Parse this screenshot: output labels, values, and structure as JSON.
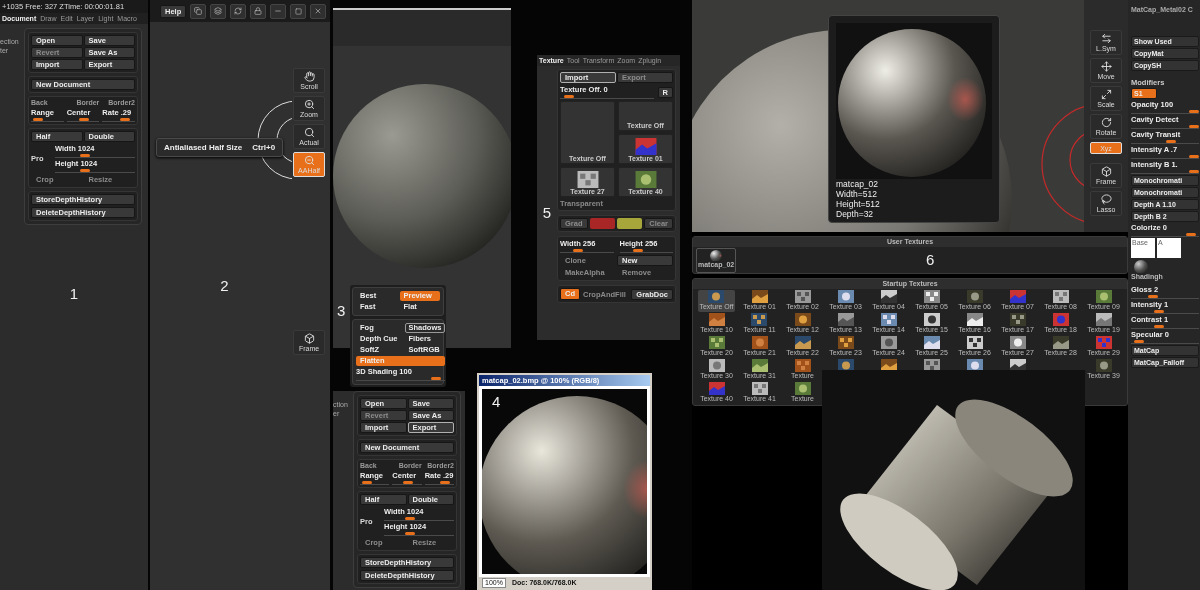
{
  "document_panel": {
    "number": "1",
    "status": "+1035 Free: 327 ZTime: 00:00:01.81",
    "tabs": [
      {
        "label": "Document",
        "selected": true
      },
      {
        "label": "Draw",
        "selected": false
      },
      {
        "label": "Edit",
        "selected": false
      },
      {
        "label": "Layer",
        "selected": false
      },
      {
        "label": "Light",
        "selected": false
      },
      {
        "label": "Macro",
        "selected": false
      }
    ],
    "side_labels": [
      "ection",
      "ter"
    ],
    "document": {
      "file_buttons": [
        {
          "label": "Open",
          "disabled": false,
          "selected": false
        },
        {
          "label": "Save",
          "disabled": false,
          "selected": false
        },
        {
          "label": "Revert",
          "disabled": true,
          "selected": false
        },
        {
          "label": "Save As",
          "disabled": false,
          "selected": false
        },
        {
          "label": "Import",
          "disabled": false,
          "selected": false
        },
        {
          "label": "Export",
          "disabled": false,
          "selected": false
        }
      ],
      "new_document": "New Document",
      "color_labels": [
        "Back",
        "Border",
        "Border2"
      ],
      "sliders": [
        {
          "label": "Range",
          "level": 0.08
        },
        {
          "label": "Center",
          "level": 0.55
        },
        {
          "label": "Rate .29",
          "level": 0.8
        }
      ],
      "size_buttons": [
        {
          "label": "Half",
          "disabled": false
        },
        {
          "label": "Double",
          "disabled": false
        }
      ],
      "pro_label": "Pro",
      "size_sliders": [
        {
          "label": "Width 1024",
          "level": 0.35
        },
        {
          "label": "Height 1024",
          "level": 0.35
        }
      ],
      "resize_buttons": [
        {
          "label": "Crop",
          "disabled": true
        },
        {
          "label": "Resize",
          "disabled": true
        }
      ],
      "history_buttons": [
        "StoreDepthHistory",
        "DeleteDepthHistory"
      ]
    }
  },
  "view_panel": {
    "number": "2",
    "help": "Help",
    "shelf": [
      {
        "label": "Scroll",
        "selected": false
      },
      {
        "label": "Zoom",
        "selected": false
      },
      {
        "label": "Actual",
        "selected": false
      },
      {
        "label": "AAHalf",
        "selected": true
      },
      {
        "label": "Frame",
        "selected": false
      }
    ],
    "tooltip": {
      "text": "Antialiased Half Size",
      "shortcut": "Ctrl+0"
    }
  },
  "render_panel": {
    "number": "3",
    "groups": [
      {
        "items": [
          {
            "kind": "option",
            "label": "Best",
            "selected": false,
            "outlined": false
          },
          {
            "kind": "option",
            "label": "Preview",
            "selected": true,
            "outlined": false
          },
          {
            "kind": "option",
            "label": "Fast",
            "selected": false,
            "outlined": false
          },
          {
            "kind": "option",
            "label": "Flat",
            "selected": false,
            "outlined": false
          }
        ]
      },
      {
        "items": [
          {
            "kind": "option",
            "label": "Fog",
            "selected": false,
            "outlined": false
          },
          {
            "kind": "option",
            "label": "Shadows",
            "selected": false,
            "outlined": true
          },
          {
            "kind": "option",
            "label": "Depth Cue",
            "selected": false,
            "outlined": false
          },
          {
            "kind": "option",
            "label": "Fibers",
            "selected": false,
            "outlined": false
          },
          {
            "kind": "option",
            "label": "SoftZ",
            "selected": false,
            "outlined": false
          },
          {
            "kind": "option",
            "label": "SoftRGB",
            "selected": false,
            "outlined": false
          },
          {
            "kind": "wide",
            "label": "Flatten",
            "selected": true,
            "outlined": false
          }
        ],
        "slider": {
          "label": "3D Shading 100",
          "level": 0.95
        }
      }
    ]
  },
  "document_panel_copy": {
    "side_labels": [
      "ction",
      "er"
    ],
    "document": {
      "file_buttons": [
        {
          "label": "Open",
          "disabled": false,
          "selected": false
        },
        {
          "label": "Save",
          "disabled": false,
          "selected": false
        },
        {
          "label": "Revert",
          "disabled": true,
          "selected": false
        },
        {
          "label": "Save As",
          "disabled": false,
          "selected": false
        },
        {
          "label": "Import",
          "disabled": false,
          "selected": false
        },
        {
          "label": "Export",
          "disabled": false,
          "selected": true
        }
      ],
      "new_document": "New Document",
      "color_labels": [
        "Back",
        "Border",
        "Border2"
      ],
      "sliders": [
        {
          "label": "Range",
          "level": 0.08
        },
        {
          "label": "Center",
          "level": 0.55
        },
        {
          "label": "Rate .29",
          "level": 0.8
        }
      ],
      "size_buttons": [
        {
          "label": "Half",
          "disabled": false
        },
        {
          "label": "Double",
          "disabled": false
        }
      ],
      "pro_label": "Pro",
      "size_sliders": [
        {
          "label": "Width 1024",
          "level": 0.35
        },
        {
          "label": "Height 1024",
          "level": 0.35
        }
      ],
      "resize_buttons": [
        {
          "label": "Crop",
          "disabled": true
        },
        {
          "label": "Resize",
          "disabled": true
        }
      ],
      "history_buttons": [
        "StoreDepthHistory",
        "DeleteDepthHistory"
      ]
    }
  },
  "image_window": {
    "number": "4",
    "title": "matcap_02.bmp @ 100% (RGB/8)",
    "zoom": "100%",
    "doc_size": "Doc: 768.0K/768.0K"
  },
  "texture_panel": {
    "number": "5",
    "tabs": [
      {
        "label": "Texture",
        "selected": true
      },
      {
        "label": "Tool",
        "selected": false
      },
      {
        "label": "Transform",
        "selected": false
      },
      {
        "label": "Zoom",
        "selected": false
      },
      {
        "label": "Zplugin",
        "selected": false
      }
    ],
    "import_buttons": [
      {
        "label": "Import",
        "disabled": false
      },
      {
        "label": "Export",
        "disabled": true
      }
    ],
    "slider": {
      "label": "Texture Off. 0",
      "level": 0.05
    },
    "reset_label": "R",
    "thumbs": [
      {
        "kind": "empty",
        "label": "Texture Off"
      },
      {
        "kind": "large",
        "label": "Texture Off"
      },
      {
        "label": "Texture 01"
      },
      {
        "label": "Texture 27"
      },
      {
        "label": "Texture 40"
      }
    ],
    "transparent": {
      "label": "Transparent",
      "disabled": true
    },
    "color_row": [
      {
        "kind": "button",
        "label": "Grad",
        "disabled": true
      },
      {
        "kind": "swatch",
        "color": "#a82626",
        "disabled": false
      },
      {
        "kind": "swatch",
        "color": "#a6a63a",
        "disabled": false
      },
      {
        "kind": "button",
        "label": "Clear",
        "disabled": true
      }
    ],
    "size_sliders": [
      {
        "label": "Width 256",
        "level": 0.3
      },
      {
        "label": "Height 256",
        "level": 0.3
      }
    ],
    "buttons": [
      {
        "label": "Clone",
        "disabled": true
      },
      {
        "label": "New",
        "disabled": false
      },
      {
        "label": "MakeAlpha",
        "disabled": true
      },
      {
        "label": "Remove",
        "disabled": true
      }
    ],
    "crop": {
      "icon_label": "Cd",
      "label": "CropAndFill",
      "disabled": true
    },
    "grab": "GrabDoc"
  },
  "material_panel": {
    "number": "6",
    "card": {
      "name": "matcap_02",
      "lines": [
        "Width=512",
        "Height=512",
        "Depth=32"
      ]
    },
    "shelf": [
      {
        "label": "L.Sym",
        "selected": false
      },
      {
        "label": "Move",
        "selected": false
      },
      {
        "label": "Scale",
        "selected": false
      },
      {
        "label": "Rotate",
        "selected": false
      },
      {
        "label": "Xyz",
        "selected": true
      },
      {
        "label": "Frame",
        "selected": false
      },
      {
        "label": "Lasso",
        "selected": false
      }
    ],
    "palette": [
      {
        "kind": "title",
        "label": "MatCap_Metal02 C"
      },
      {
        "kind": "button",
        "label": "Show Used"
      },
      {
        "kind": "button",
        "label": "CopyMat"
      },
      {
        "kind": "button",
        "label": "CopySH"
      },
      {
        "kind": "header",
        "label": "Modifiers"
      },
      {
        "kind": "toggle",
        "label": "S1",
        "selected": true
      },
      {
        "kind": "slider",
        "label": "Opacity 100",
        "level": 1
      },
      {
        "kind": "slider",
        "label": "Cavity Detect",
        "level": 1
      },
      {
        "kind": "slider",
        "label": "Cavity Transit",
        "level": 0.6
      },
      {
        "kind": "slider",
        "label": "Intensity A .7",
        "level": 1
      },
      {
        "kind": "slider",
        "label": "Intensity B 1.",
        "level": 1
      },
      {
        "kind": "button",
        "label": "Monochromati"
      },
      {
        "kind": "button",
        "label": "Monochromati"
      },
      {
        "kind": "button",
        "label": "Depth A 1.10"
      },
      {
        "kind": "button",
        "label": "Depth B 2"
      },
      {
        "kind": "slider",
        "label": "Colorize 0",
        "level": 0.95
      },
      {
        "kind": "swatches",
        "labels": [
          "Base",
          "A"
        ]
      },
      {
        "kind": "thumb",
        "label": "Shadingh"
      },
      {
        "kind": "slider",
        "label": "Gloss 2",
        "level": 0.3
      },
      {
        "kind": "slider",
        "label": "Intensity 1",
        "level": 0.4
      },
      {
        "kind": "slider",
        "label": "Contrast 1",
        "level": 0.4
      },
      {
        "kind": "slider",
        "label": "Specular 0",
        "level": 0.05
      },
      {
        "kind": "button",
        "label": "MatCap"
      },
      {
        "kind": "button",
        "label": "MatCap_Falloff"
      }
    ],
    "user_textures": {
      "title": "User Textures",
      "items": [
        {
          "label": "matcap_02",
          "selected": false
        }
      ]
    },
    "startup_textures": {
      "title": "Startup Textures",
      "items": [
        {
          "kind": "tile",
          "label": "Texture Off",
          "selected": true
        },
        {
          "kind": "tile",
          "label": "Texture 01",
          "selected": false
        },
        {
          "kind": "tile",
          "label": "Texture 02",
          "selected": false
        },
        {
          "kind": "tile",
          "label": "Texture 03",
          "selected": false
        },
        {
          "kind": "tile",
          "label": "Texture 04",
          "selected": false
        },
        {
          "kind": "tile",
          "label": "Texture 05",
          "selected": false
        },
        {
          "kind": "tile",
          "label": "Texture 06",
          "selected": false
        },
        {
          "kind": "tile",
          "label": "Texture 07",
          "selected": false
        },
        {
          "kind": "tile",
          "label": "Texture 08",
          "selected": false
        },
        {
          "kind": "tile",
          "label": "Texture 09",
          "selected": false
        },
        {
          "kind": "tile",
          "label": "Texture 10",
          "selected": false
        },
        {
          "kind": "tile",
          "label": "Texture 11",
          "selected": false
        },
        {
          "kind": "tile",
          "label": "Texture 12",
          "selected": false
        },
        {
          "kind": "tile",
          "label": "Texture 13",
          "selected": false
        },
        {
          "kind": "tile",
          "label": "Texture 14",
          "selected": false
        },
        {
          "kind": "tile",
          "label": "Texture 15",
          "selected": false
        },
        {
          "kind": "tile",
          "label": "Texture 16",
          "selected": false
        },
        {
          "kind": "tile",
          "label": "Texture 17",
          "selected": false
        },
        {
          "kind": "tile",
          "label": "Texture 18",
          "selected": false
        },
        {
          "kind": "tile",
          "label": "Texture 19",
          "selected": false
        },
        {
          "kind": "tile",
          "label": "Texture 20",
          "selected": false
        },
        {
          "kind": "tile",
          "label": "Texture 21",
          "selected": false
        },
        {
          "kind": "tile",
          "label": "Texture 22",
          "selected": false
        },
        {
          "kind": "tile",
          "label": "Texture 23",
          "selected": false
        },
        {
          "kind": "tile",
          "label": "Texture 24",
          "selected": false
        },
        {
          "kind": "tile",
          "label": "Texture 25",
          "selected": false
        },
        {
          "kind": "tile",
          "label": "Texture 26",
          "selected": false
        },
        {
          "kind": "tile",
          "label": "Texture 27",
          "selected": false
        },
        {
          "kind": "tile",
          "label": "Texture 28",
          "selected": false
        },
        {
          "kind": "tile",
          "label": "Texture 29",
          "selected": false
        },
        {
          "kind": "tile",
          "label": "Texture 30",
          "selected": false
        },
        {
          "kind": "tile",
          "label": "Texture 31",
          "selected": false
        },
        {
          "kind": "tile",
          "label": "Texture",
          "selected": false
        },
        {
          "kind": "thumb",
          "selected": false
        },
        {
          "kind": "thumb",
          "selected": false
        },
        {
          "kind": "thumb",
          "selected": false
        },
        {
          "kind": "thumb",
          "selected": false
        },
        {
          "kind": "thumb",
          "selected": false
        },
        {
          "kind": "empty",
          "selected": false
        },
        {
          "kind": "tile",
          "label": "Texture 39",
          "selected": false
        },
        {
          "kind": "tile",
          "label": "Texture 40",
          "selected": false
        },
        {
          "kind": "tile",
          "label": "Texture 41",
          "selected": false
        },
        {
          "kind": "tile",
          "label": "Texture",
          "selected": false
        }
      ]
    }
  }
}
